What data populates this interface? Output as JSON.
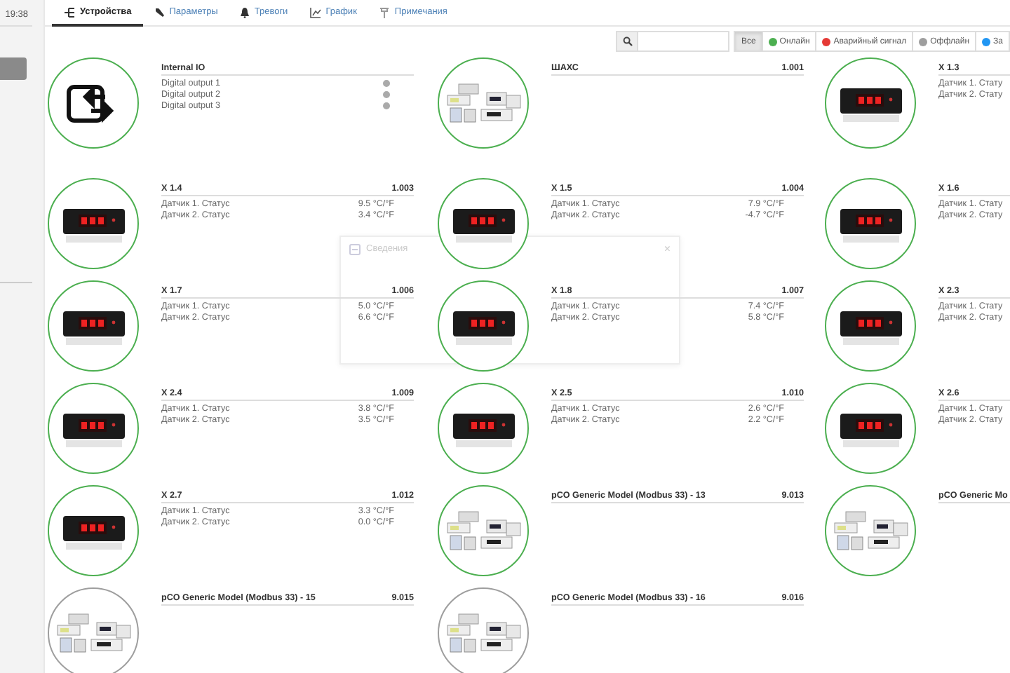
{
  "sidebar": {
    "time": "19:38"
  },
  "tabs": [
    {
      "label": "Устройства",
      "selected": true
    },
    {
      "label": "Параметры",
      "selected": false
    },
    {
      "label": "Тревоги",
      "selected": false
    },
    {
      "label": "График",
      "selected": false
    },
    {
      "label": "Примечания",
      "selected": false
    }
  ],
  "filters": [
    {
      "label": "Все",
      "selected": true
    },
    {
      "label": "Онлайн",
      "color": "#4caf50",
      "selected": false
    },
    {
      "label": "Аварийный сигнал",
      "color": "#e53935",
      "selected": false
    },
    {
      "label": "Оффлайн",
      "color": "#9e9e9e",
      "selected": false
    },
    {
      "label": "За",
      "color": "#2196f3",
      "selected": false
    }
  ],
  "devices": [
    {
      "name": "Internal IO",
      "kind": "io",
      "color": "#4caf50",
      "rows": [
        {
          "label": "Digital output 1",
          "kind": "indicator",
          "on": false
        },
        {
          "label": "Digital output 2",
          "kind": "indicator",
          "on": false
        },
        {
          "label": "Digital output 3",
          "kind": "indicator",
          "on": false
        }
      ]
    },
    {
      "name": "ШАХС",
      "address": "1.001",
      "kind": "pco",
      "color": "#4caf50"
    },
    {
      "name": "X 1.3",
      "kind": "controller",
      "color": "#4caf50",
      "rows": [
        {
          "label": "Датчик 1. Стату",
          "kind": "value"
        },
        {
          "label": "Датчик 2. Стату",
          "kind": "value"
        }
      ]
    },
    {
      "name": "X 1.4",
      "address": "1.003",
      "kind": "controller",
      "color": "#4caf50",
      "rows": [
        {
          "label": "Датчик 1. Статус",
          "kind": "value",
          "value": "9.5 °C/°F"
        },
        {
          "label": "Датчик 2. Статус",
          "kind": "value",
          "value": "3.4 °C/°F"
        }
      ]
    },
    {
      "name": "X 1.5",
      "address": "1.004",
      "kind": "controller",
      "color": "#4caf50",
      "rows": [
        {
          "label": "Датчик 1. Статус",
          "kind": "value",
          "value": "7.9 °C/°F"
        },
        {
          "label": "Датчик 2. Статус",
          "kind": "value",
          "value": "-4.7 °C/°F"
        }
      ]
    },
    {
      "name": "X 1.6",
      "kind": "controller",
      "color": "#4caf50",
      "rows": [
        {
          "label": "Датчик 1. Стату",
          "kind": "value"
        },
        {
          "label": "Датчик 2. Стату",
          "kind": "value"
        }
      ]
    },
    {
      "name": "X 1.7",
      "address": "1.006",
      "kind": "controller",
      "color": "#4caf50",
      "rows": [
        {
          "label": "Датчик 1. Статус",
          "kind": "value",
          "value": "5.0 °C/°F"
        },
        {
          "label": "Датчик 2. Статус",
          "kind": "value",
          "value": "6.6 °C/°F"
        }
      ]
    },
    {
      "name": "X 1.8",
      "address": "1.007",
      "kind": "controller",
      "color": "#4caf50",
      "rows": [
        {
          "label": "Датчик 1. Статус",
          "kind": "value",
          "value": "7.4 °C/°F"
        },
        {
          "label": "Датчик 2. Статус",
          "kind": "value",
          "value": "5.8 °C/°F"
        }
      ]
    },
    {
      "name": "X 2.3",
      "kind": "controller",
      "color": "#4caf50",
      "rows": [
        {
          "label": "Датчик 1. Стату",
          "kind": "value"
        },
        {
          "label": "Датчик 2. Стату",
          "kind": "value"
        }
      ]
    },
    {
      "name": "X 2.4",
      "address": "1.009",
      "kind": "controller",
      "color": "#4caf50",
      "rows": [
        {
          "label": "Датчик 1. Статус",
          "kind": "value",
          "value": "3.8 °C/°F"
        },
        {
          "label": "Датчик 2. Статус",
          "kind": "value",
          "value": "3.5 °C/°F"
        }
      ]
    },
    {
      "name": "X 2.5",
      "address": "1.010",
      "kind": "controller",
      "color": "#4caf50",
      "rows": [
        {
          "label": "Датчик 1. Статус",
          "kind": "value",
          "value": "2.6 °C/°F"
        },
        {
          "label": "Датчик 2. Статус",
          "kind": "value",
          "value": "2.2 °C/°F"
        }
      ]
    },
    {
      "name": "X 2.6",
      "kind": "controller",
      "color": "#4caf50",
      "rows": [
        {
          "label": "Датчик 1. Стату",
          "kind": "value"
        },
        {
          "label": "Датчик 2. Стату",
          "kind": "value"
        }
      ]
    },
    {
      "name": "X 2.7",
      "address": "1.012",
      "kind": "controller",
      "color": "#4caf50",
      "rows": [
        {
          "label": "Датчик 1. Статус",
          "kind": "value",
          "value": "3.3 °C/°F"
        },
        {
          "label": "Датчик 2. Статус",
          "kind": "value",
          "value": "0.0 °C/°F"
        }
      ]
    },
    {
      "name": "pCO Generic Model (Modbus 33) - 13",
      "address": "9.013",
      "kind": "pco",
      "color": "#4caf50"
    },
    {
      "name": "pCO Generic Mo",
      "kind": "pco",
      "color": "#4caf50"
    },
    {
      "name": "pCO Generic Model (Modbus 33) - 15",
      "address": "9.015",
      "kind": "pco",
      "color": "#9e9e9e"
    },
    {
      "name": "pCO Generic Model (Modbus 33) - 16",
      "address": "9.016",
      "kind": "pco",
      "color": "#9e9e9e"
    }
  ],
  "dialog": {
    "title": "Сведения",
    "close": "×"
  }
}
